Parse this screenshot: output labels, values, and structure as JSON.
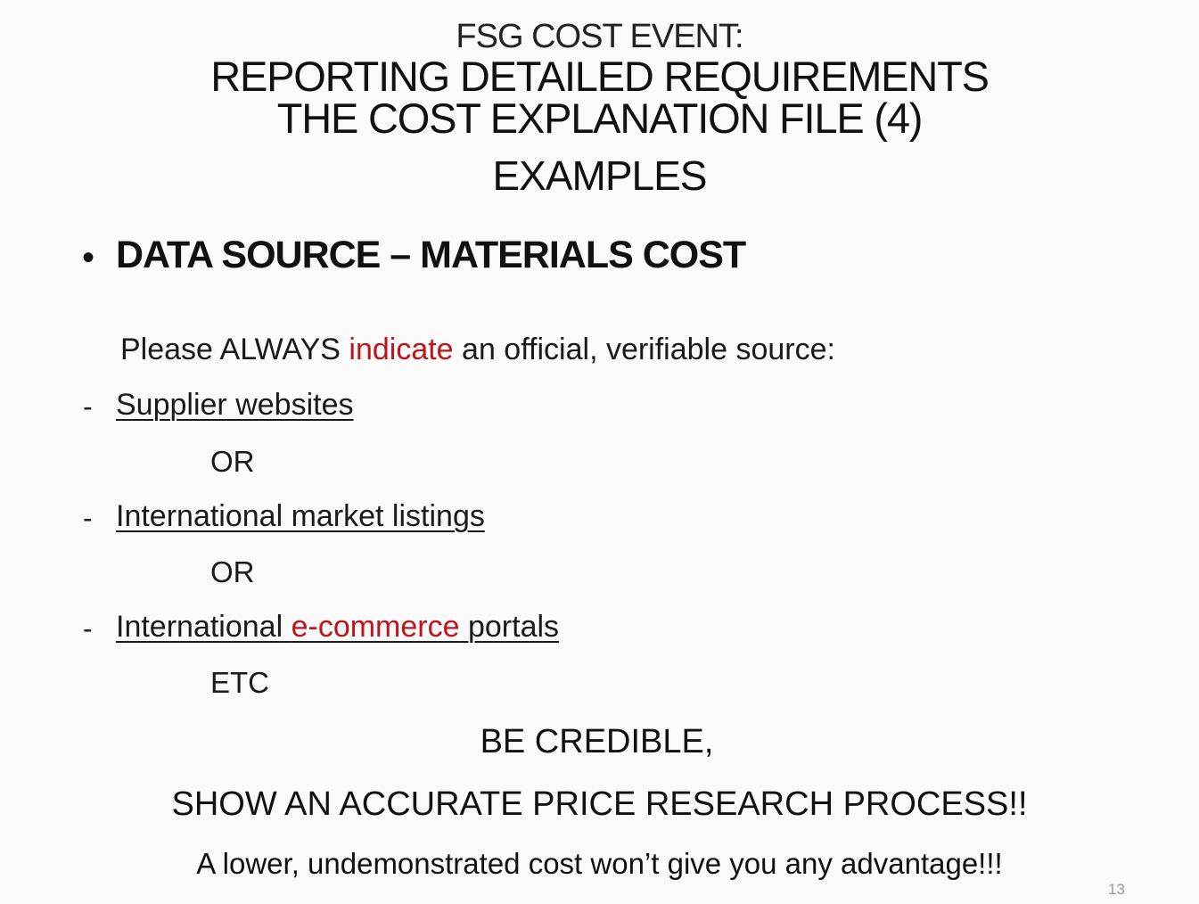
{
  "slide": {
    "title_top": "FSG COST EVENT:",
    "title_line1": "REPORTING DETAILED REQUIREMENTS",
    "title_line2": "THE COST EXPLANATION FILE (4)",
    "subtitle": "EXAMPLES",
    "bullet_marker": "•",
    "bullet_heading": "DATA SOURCE – MATERIALS COST",
    "instruction": {
      "before": "Please ALWAYS ",
      "highlight": "indicate",
      "after": " an official, verifiable source:"
    },
    "dash": "-",
    "sources": [
      {
        "text": "Supplier websites"
      },
      {
        "text": "International market listings"
      },
      {
        "before": "International ",
        "highlight": "e-commerce",
        "after": " portals"
      }
    ],
    "connectors": [
      "OR",
      "OR",
      "ETC"
    ],
    "credible_line1": "BE CREDIBLE,",
    "credible_line2": "SHOW AN ACCURATE PRICE RESEARCH PROCESS!!",
    "final_note": "A lower, undemonstrated cost won’t give you any advantage!!!",
    "page_number": "13"
  },
  "colors": {
    "background": "#fafafa",
    "text": "#1a1a1a",
    "highlight_red": "#c0141c",
    "page_number": "#9a9a9a"
  }
}
